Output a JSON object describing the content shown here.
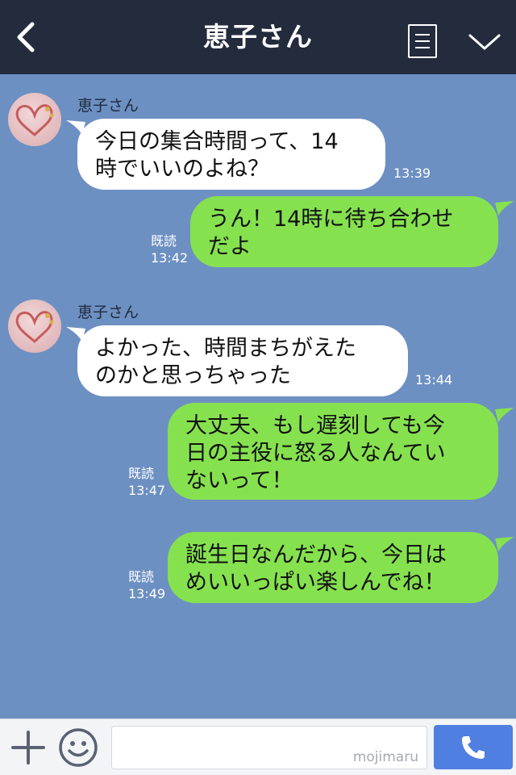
{
  "header": {
    "title": "恵子さん",
    "back_icon": "chevron-left-icon",
    "menu_icon": "menu-icon",
    "expand_icon": "chevron-down-icon"
  },
  "messages": [
    {
      "direction": "in",
      "sender": "恵子さん",
      "text": "今日の集合時間って、14\n時でいいのよね？",
      "time": "13:39"
    },
    {
      "direction": "out",
      "read": "既読",
      "text": "うん！14時に待ち合わせ\nだよ",
      "time": "13:42"
    },
    {
      "direction": "in",
      "sender": "恵子さん",
      "text": "よかった、時間まちがえた\nのかと思っちゃった",
      "time": "13:44"
    },
    {
      "direction": "out",
      "read": "既読",
      "text": "大丈夫、もし遅刻しても今\n日の主役に怒る人なんてい\nないって！",
      "time": "13:47"
    },
    {
      "direction": "out",
      "read": "既読",
      "text": "誕生日なんだから、今日は\nめいいっぱい楽しんでね！",
      "time": "13:49"
    }
  ],
  "footer": {
    "plus_icon": "plus-icon",
    "emoji_icon": "smile-icon",
    "input_value": "",
    "watermark": "mojimaru",
    "call_icon": "phone-icon"
  },
  "colors": {
    "header_bg": "#232b3d",
    "chat_bg": "#6d90c2",
    "incoming_bubble": "#ffffff",
    "outgoing_bubble": "#86e14f",
    "call_button": "#4f7fe0"
  }
}
